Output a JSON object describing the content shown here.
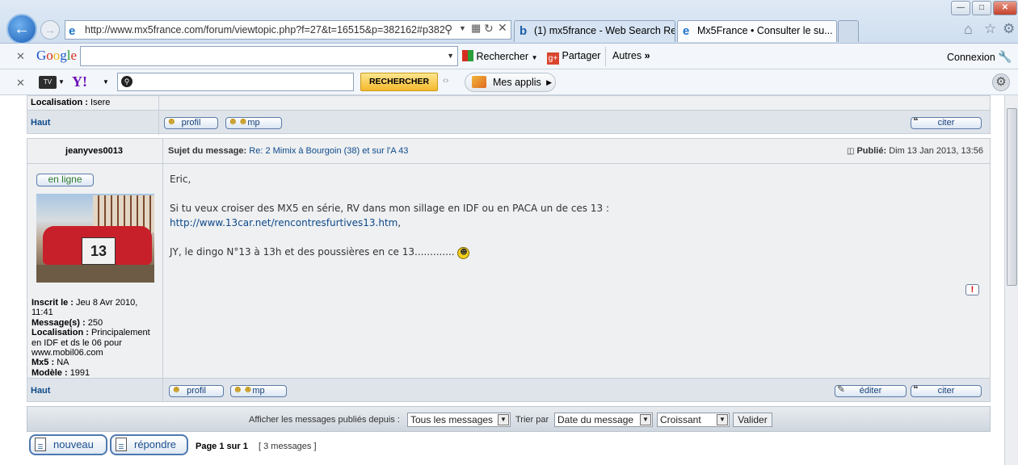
{
  "browser": {
    "address_url": "http://www.mx5france.com/forum/viewtopic.php?f=27&t=16515&p=382162#p382",
    "tabs": [
      {
        "label": "(1) mx5france - Web Search Re..."
      },
      {
        "label": "Mx5France • Consulter le su..."
      }
    ],
    "google_bar": {
      "logo": "Google",
      "search_label": "Rechercher",
      "share_label": "Partager",
      "more_label": "Autres",
      "login_label": "Connexion"
    },
    "yahoo_bar": {
      "search_button": "RECHERCHER",
      "apps_label": "Mes applis",
      "tv_label": "TV"
    }
  },
  "forum": {
    "prev_post": {
      "localisation_label": "Localisation :",
      "localisation_value": "Isere",
      "top_link": "Haut",
      "profil": "profil",
      "mp": "mp",
      "citer": "citer"
    },
    "post": {
      "author": "jeanyves0013",
      "subject_label": "Sujet du message:",
      "subject_value": "Re: 2 Mimix à Bourgoin (38) et sur l'A 43",
      "published_label": "Publié:",
      "published_value": "Dim 13 Jan 2013, 13:56",
      "online_badge": "en ligne",
      "avatar_number": "13",
      "body_lines": [
        "Eric,",
        "Si tu veux croiser des MX5 en série, RV dans mon sillage en IDF ou en PACA un de ces 13 :",
        "http://www.13car.net/rencontresfurtives13.htm",
        ",",
        "JY, le dingo N°13 à 13h et des poussières en ce 13............."
      ],
      "profile": {
        "inscrit_label": "Inscrit le :",
        "inscrit_value": "Jeu 8 Avr 2010, 11:41",
        "messages_label": "Message(s) :",
        "messages_value": "250",
        "localisation_label": "Localisation :",
        "localisation_value": "Principalement en IDF et ds le 06 pour www.mobil06.com",
        "mx5_label": "Mx5 :",
        "mx5_value": "NA",
        "model_label": "Modèle :",
        "model_value": "1991"
      },
      "top_link": "Haut",
      "profil": "profil",
      "mp": "mp",
      "editer": "éditer",
      "citer": "citer"
    },
    "filter": {
      "show_label": "Afficher les messages publiés depuis :",
      "period_value": "Tous les messages",
      "sort_label": "Trier par",
      "sort_value": "Date du message",
      "order_value": "Croissant",
      "submit_label": "Valider"
    },
    "footer": {
      "new_label": "nouveau",
      "reply_label": "répondre",
      "page_info": "Page 1 sur 1",
      "messages_count": "[ 3 messages ]"
    }
  },
  "colors": {
    "accent": "#0e4a8a",
    "panel_bg": "#eef0f2",
    "row_dark": "#dfe4ea",
    "yahoo_button": "#fbd25a"
  }
}
